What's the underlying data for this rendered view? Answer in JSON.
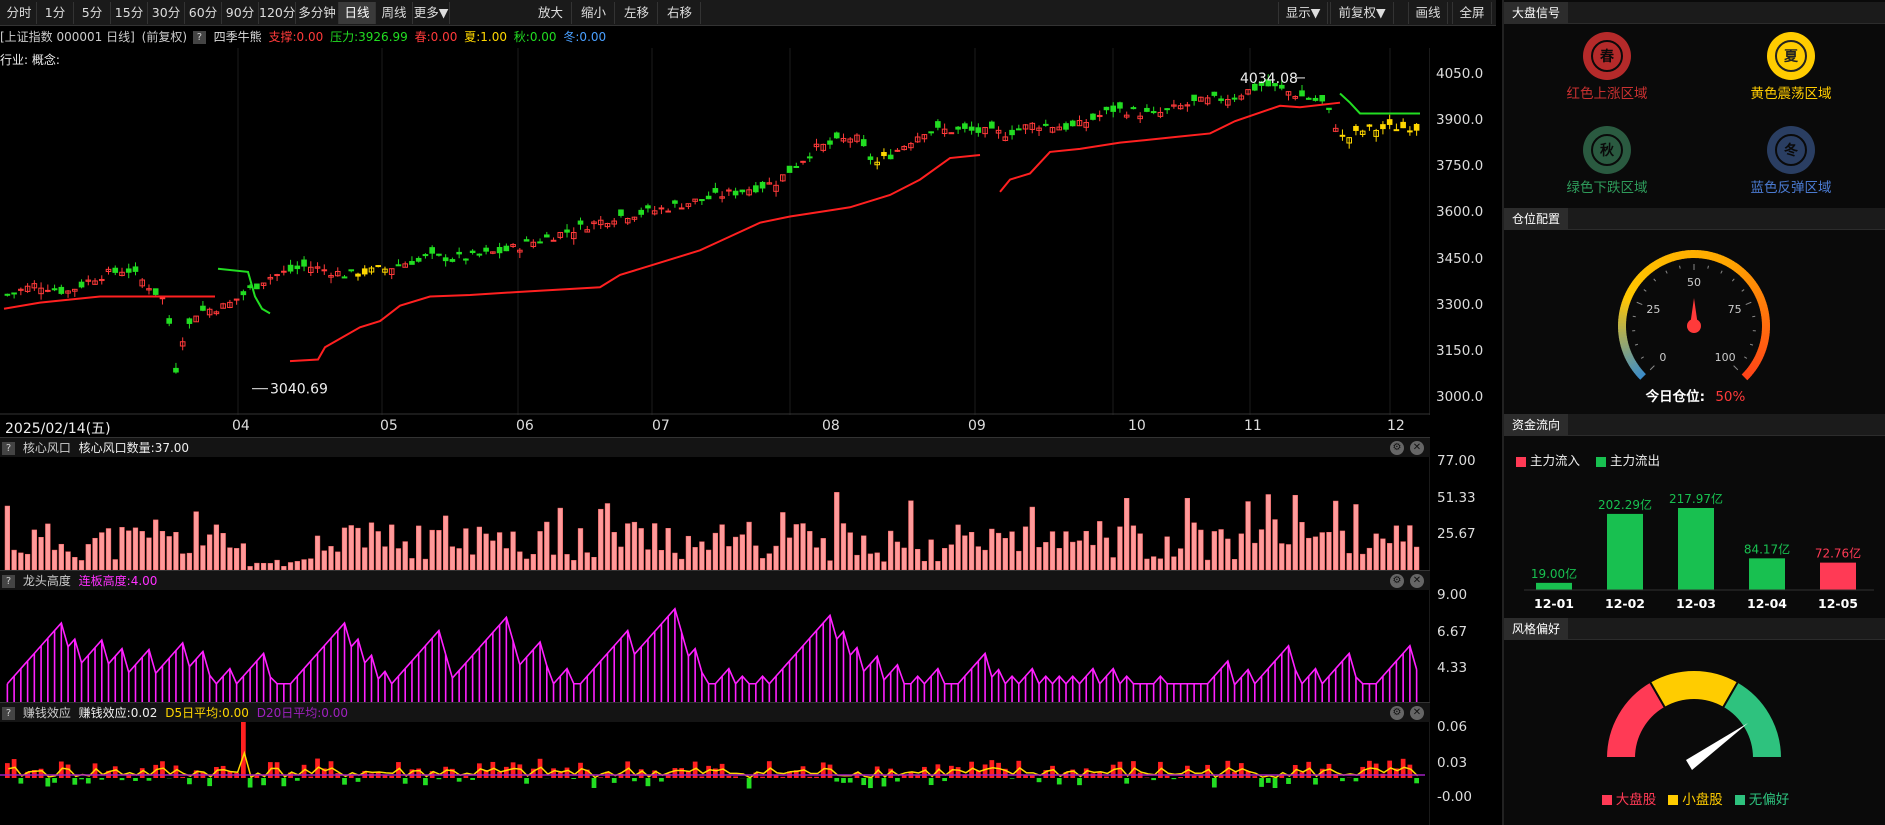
{
  "toolbar": {
    "periods": [
      "分时",
      "1分",
      "5分",
      "15分",
      "30分",
      "60分",
      "90分",
      "120分",
      "多分钟",
      "日线",
      "周线",
      "更多▼"
    ],
    "active": "日线",
    "zoom_in": "放大",
    "zoom_out": "缩小",
    "left": "左移",
    "right": "右移",
    "display": "显示▼",
    "adjust": "前复权▼",
    "draw": "画线",
    "fullscreen": "全屏"
  },
  "info": {
    "security": "[上证指数 000001 日线]",
    "adjust": "(前复权)",
    "indicator": "四季牛熊",
    "support": "支撑:0.00",
    "pressure": "压力:3926.99",
    "spring": "春:0.00",
    "summer": "夏:1.00",
    "autumn": "秋:0.00",
    "winter": "冬:0.00"
  },
  "industry_label": "行业: 概念:",
  "main_chart": {
    "y_ticks": [
      "4050.0",
      "3900.0",
      "3750.0",
      "3600.0",
      "3450.0",
      "3300.0",
      "3150.0",
      "3000.0"
    ],
    "high_label": "4034.08",
    "low_label": "3040.69",
    "date": "2025/02/14(五)",
    "months": [
      "04",
      "05",
      "06",
      "07",
      "08",
      "09",
      "10",
      "11",
      "12"
    ]
  },
  "sub1": {
    "name": "核心风口",
    "label": "核心风口数量:37.00",
    "y_ticks": [
      "77.00",
      "51.33",
      "25.67"
    ]
  },
  "sub2": {
    "name": "龙头高度",
    "label": "连板高度:4.00",
    "y_ticks": [
      "9.00",
      "6.67",
      "4.33"
    ]
  },
  "sub3": {
    "name": "赚钱效应",
    "label": "赚钱效应:0.02",
    "d5": "D5日平均:0.00",
    "d20": "D20日平均:0.00",
    "y_ticks": [
      "0.06",
      "0.03",
      "-0.00"
    ]
  },
  "right": {
    "signal_title": "大盘信号",
    "signals": [
      {
        "char": "春",
        "label": "红色上涨区域",
        "active": false
      },
      {
        "char": "夏",
        "label": "黄色震荡区域",
        "active": true
      },
      {
        "char": "秋",
        "label": "绿色下跌区域",
        "active": false
      },
      {
        "char": "冬",
        "label": "蓝色反弹区域",
        "active": false
      }
    ],
    "position_title": "仓位配置",
    "gauge_ticks": [
      "0",
      "25",
      "50",
      "75",
      "100"
    ],
    "position_label": "今日仓位:",
    "position_value": "50%",
    "position_pct": 50,
    "flow_title": "资金流向",
    "flow_in": "主力流入",
    "flow_out": "主力流出",
    "flows": [
      {
        "date": "12-01",
        "value": "19.00亿",
        "v": 19,
        "dir": "out"
      },
      {
        "date": "12-02",
        "value": "202.29亿",
        "v": 202.29,
        "dir": "out"
      },
      {
        "date": "12-03",
        "value": "217.97亿",
        "v": 217.97,
        "dir": "out"
      },
      {
        "date": "12-04",
        "value": "84.17亿",
        "v": 84.17,
        "dir": "out"
      },
      {
        "date": "12-05",
        "value": "72.76亿",
        "v": 72.76,
        "dir": "in"
      }
    ],
    "style_title": "风格偏好",
    "style_legend": [
      "大盘股",
      "小盘股",
      "无偏好"
    ]
  },
  "colors": {
    "up": "#ff3a3a",
    "down": "#22dd22",
    "yellow": "#ffd700",
    "magenta": "#ff20ff",
    "pink": "#ff9a9a",
    "gold": "#ffcc00",
    "green_flow": "#18c050",
    "red_flow": "#ff3a55"
  }
}
